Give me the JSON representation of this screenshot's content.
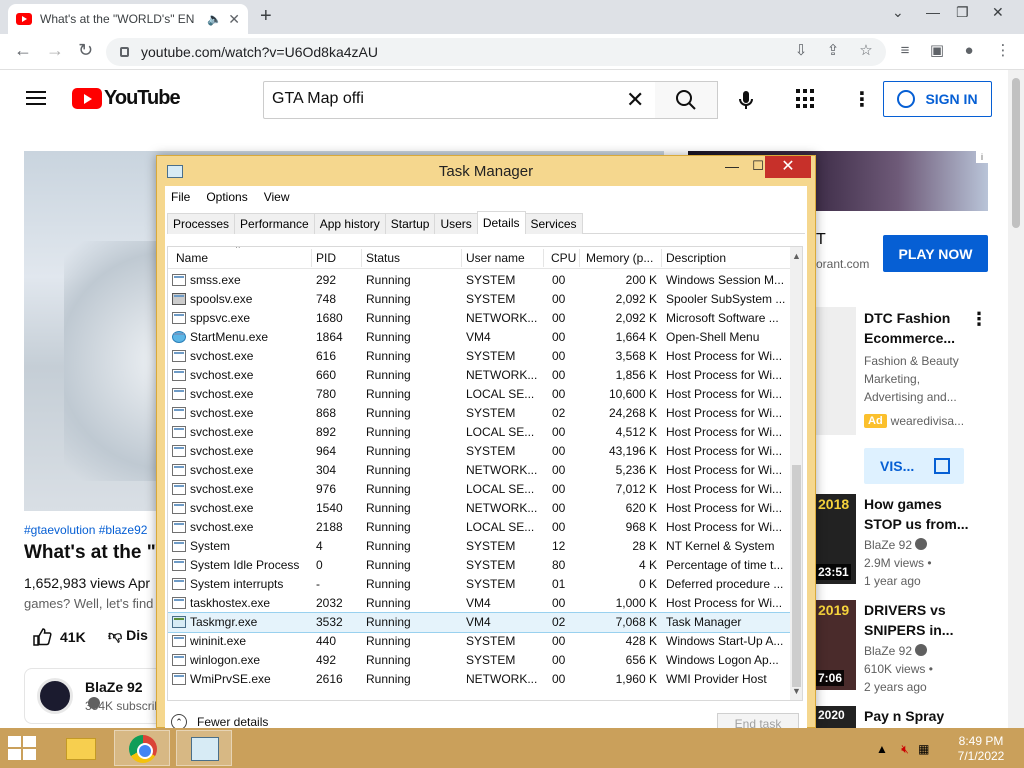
{
  "browser": {
    "tab_title": "What's at the \"WORLD's\" EN",
    "new_tab": "+",
    "url": "youtube.com/watch?v=U6Od8ka4zAU"
  },
  "youtube": {
    "logo_text": "YouTube",
    "search_value": "GTA Map offi",
    "sign_in": "SIGN IN",
    "hashtags": "#gtaevolution #blaze92",
    "video_title": "What's at the \"W",
    "views": "1,652,983 views  Apr",
    "description": "games? Well, let's find",
    "likes": "41K",
    "dislike": "Dis",
    "channel_name": "BlaZe 92",
    "channel_subs": "354K subscrib"
  },
  "sidebar": {
    "ad_text": "T",
    "ad_url": "orant.com",
    "play_now": "PLAY NOW",
    "ad_card_title": "DTC Fashion Ecommerce...",
    "ad_card_desc": "Fashion & Beauty Marketing, Advertising and...",
    "ad_label": "Ad",
    "ad_advertiser": "wearedivisa...",
    "visit": "VIS...",
    "recs": [
      {
        "title": "How games STOP us from...",
        "channel": "BlaZe 92",
        "views": "2.9M views •",
        "age": "1 year ago",
        "duration": "23:51",
        "thumb_text": "2018"
      },
      {
        "title": "DRIVERS vs SNIPERS in...",
        "channel": "BlaZe 92",
        "views": "610K views •",
        "age": "2 years ago",
        "duration": "7:06",
        "thumb_text": "2019"
      },
      {
        "title": "Pay n Spray",
        "channel": "",
        "views": "",
        "age": "",
        "duration": "",
        "thumb_text": "2020"
      }
    ]
  },
  "taskmanager": {
    "title": "Task Manager",
    "menu": [
      "File",
      "Options",
      "View"
    ],
    "tabs": [
      "Processes",
      "Performance",
      "App history",
      "Startup",
      "Users",
      "Details",
      "Services"
    ],
    "active_tab": "Details",
    "columns": [
      "Name",
      "PID",
      "Status",
      "User name",
      "CPU",
      "Memory (p...",
      "Description"
    ],
    "rows": [
      {
        "name": "smss.exe",
        "pid": "292",
        "status": "Running",
        "user": "SYSTEM",
        "cpu": "00",
        "mem": "200 K",
        "desc": "Windows Session M...",
        "icon": "window"
      },
      {
        "name": "spoolsv.exe",
        "pid": "748",
        "status": "Running",
        "user": "SYSTEM",
        "cpu": "00",
        "mem": "2,092 K",
        "desc": "Spooler SubSystem ...",
        "icon": "printer"
      },
      {
        "name": "sppsvc.exe",
        "pid": "1680",
        "status": "Running",
        "user": "NETWORK...",
        "cpu": "00",
        "mem": "2,092 K",
        "desc": "Microsoft Software ...",
        "icon": "window"
      },
      {
        "name": "StartMenu.exe",
        "pid": "1864",
        "status": "Running",
        "user": "VM4",
        "cpu": "00",
        "mem": "1,664 K",
        "desc": "Open-Shell Menu",
        "icon": "globe"
      },
      {
        "name": "svchost.exe",
        "pid": "616",
        "status": "Running",
        "user": "SYSTEM",
        "cpu": "00",
        "mem": "3,568 K",
        "desc": "Host Process for Wi...",
        "icon": "window"
      },
      {
        "name": "svchost.exe",
        "pid": "660",
        "status": "Running",
        "user": "NETWORK...",
        "cpu": "00",
        "mem": "1,856 K",
        "desc": "Host Process for Wi...",
        "icon": "window"
      },
      {
        "name": "svchost.exe",
        "pid": "780",
        "status": "Running",
        "user": "LOCAL SE...",
        "cpu": "00",
        "mem": "10,600 K",
        "desc": "Host Process for Wi...",
        "icon": "window"
      },
      {
        "name": "svchost.exe",
        "pid": "868",
        "status": "Running",
        "user": "SYSTEM",
        "cpu": "02",
        "mem": "24,268 K",
        "desc": "Host Process for Wi...",
        "icon": "window"
      },
      {
        "name": "svchost.exe",
        "pid": "892",
        "status": "Running",
        "user": "LOCAL SE...",
        "cpu": "00",
        "mem": "4,512 K",
        "desc": "Host Process for Wi...",
        "icon": "window"
      },
      {
        "name": "svchost.exe",
        "pid": "964",
        "status": "Running",
        "user": "SYSTEM",
        "cpu": "00",
        "mem": "43,196 K",
        "desc": "Host Process for Wi...",
        "icon": "window"
      },
      {
        "name": "svchost.exe",
        "pid": "304",
        "status": "Running",
        "user": "NETWORK...",
        "cpu": "00",
        "mem": "5,236 K",
        "desc": "Host Process for Wi...",
        "icon": "window"
      },
      {
        "name": "svchost.exe",
        "pid": "976",
        "status": "Running",
        "user": "LOCAL SE...",
        "cpu": "00",
        "mem": "7,012 K",
        "desc": "Host Process for Wi...",
        "icon": "window"
      },
      {
        "name": "svchost.exe",
        "pid": "1540",
        "status": "Running",
        "user": "NETWORK...",
        "cpu": "00",
        "mem": "620 K",
        "desc": "Host Process for Wi...",
        "icon": "window"
      },
      {
        "name": "svchost.exe",
        "pid": "2188",
        "status": "Running",
        "user": "LOCAL SE...",
        "cpu": "00",
        "mem": "968 K",
        "desc": "Host Process for Wi...",
        "icon": "window"
      },
      {
        "name": "System",
        "pid": "4",
        "status": "Running",
        "user": "SYSTEM",
        "cpu": "12",
        "mem": "28 K",
        "desc": "NT Kernel & System",
        "icon": "window"
      },
      {
        "name": "System Idle Process",
        "pid": "0",
        "status": "Running",
        "user": "SYSTEM",
        "cpu": "80",
        "mem": "4 K",
        "desc": "Percentage of time t...",
        "icon": "window"
      },
      {
        "name": "System interrupts",
        "pid": "-",
        "status": "Running",
        "user": "SYSTEM",
        "cpu": "01",
        "mem": "0 K",
        "desc": "Deferred procedure ...",
        "icon": "window"
      },
      {
        "name": "taskhostex.exe",
        "pid": "2032",
        "status": "Running",
        "user": "VM4",
        "cpu": "00",
        "mem": "1,000 K",
        "desc": "Host Process for Wi...",
        "icon": "window"
      },
      {
        "name": "Taskmgr.exe",
        "pid": "3532",
        "status": "Running",
        "user": "VM4",
        "cpu": "02",
        "mem": "7,068 K",
        "desc": "Task Manager",
        "icon": "monitor",
        "selected": true
      },
      {
        "name": "wininit.exe",
        "pid": "440",
        "status": "Running",
        "user": "SYSTEM",
        "cpu": "00",
        "mem": "428 K",
        "desc": "Windows Start-Up A...",
        "icon": "window"
      },
      {
        "name": "winlogon.exe",
        "pid": "492",
        "status": "Running",
        "user": "SYSTEM",
        "cpu": "00",
        "mem": "656 K",
        "desc": "Windows Logon Ap...",
        "icon": "window"
      },
      {
        "name": "WmiPrvSE.exe",
        "pid": "2616",
        "status": "Running",
        "user": "NETWORK...",
        "cpu": "00",
        "mem": "1,960 K",
        "desc": "WMI Provider Host",
        "icon": "window"
      }
    ],
    "fewer_details": "Fewer details",
    "end_task": "End task"
  },
  "taskbar": {
    "time": "8:49 PM",
    "date": "7/1/2022"
  }
}
